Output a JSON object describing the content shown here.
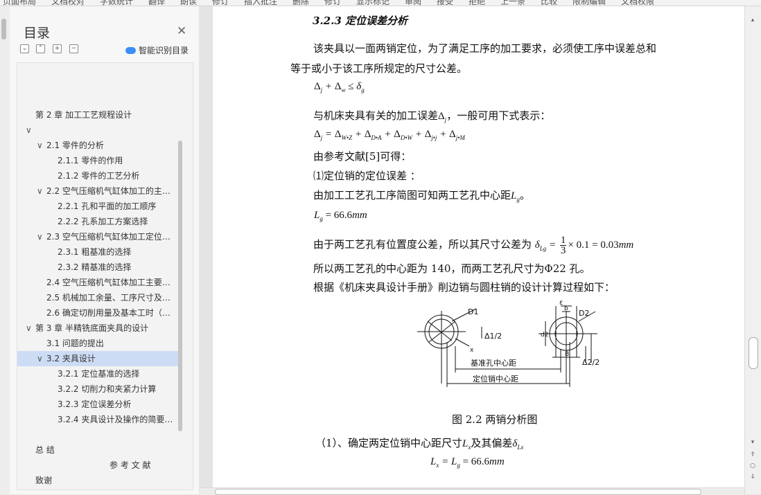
{
  "toolbar": {
    "items": [
      "页面布局",
      "文档校对",
      "字数统计",
      "翻译",
      "朗读",
      "修订",
      "插入批注",
      "删除",
      "修订",
      "显示标记",
      "审阅",
      "接受",
      "拒绝",
      "上一条",
      "比较",
      "限制编辑",
      "文档权限"
    ]
  },
  "toc": {
    "title": "目录",
    "ai_label": "智能识别目录",
    "tool_icons": [
      "⌄",
      "⌃",
      "+",
      "−"
    ],
    "items": [
      {
        "label": "第 2 章  加工工艺规程设计",
        "level": 0
      },
      {
        "label": "",
        "level": 0,
        "expander": "∨"
      },
      {
        "label": "2.1  零件的分析",
        "level": 1,
        "expander": "∨"
      },
      {
        "label": "2.1.1  零件的作用",
        "level": 2
      },
      {
        "label": "2.1.2  零件的工艺分析",
        "level": 2
      },
      {
        "label": "2.2  空气压缩机气缸体加工的主…",
        "level": 1,
        "expander": "∨"
      },
      {
        "label": "2.2.1  孔和平面的加工顺序",
        "level": 2
      },
      {
        "label": "2.2.2  孔系加工方案选择",
        "level": 2
      },
      {
        "label": "2.3  空气压缩机气缸体加工定位…",
        "level": 1,
        "expander": "∨"
      },
      {
        "label": "2.3.1  粗基准的选择",
        "level": 2
      },
      {
        "label": "2.3.2  精基准的选择",
        "level": 2
      },
      {
        "label": "2.4  空气压缩机气缸体加工主要…",
        "level": 1
      },
      {
        "label": "2.5  机械加工余量、工序尺寸及…",
        "level": 1
      },
      {
        "label": "2.6 确定切削用量及基本工时（…",
        "level": 1
      },
      {
        "label": "第 3 章  半精铣底面夹具的设计",
        "level": 0,
        "expander": "∨"
      },
      {
        "label": "3.1  问题的提出",
        "level": 1
      },
      {
        "label": "3.2  夹具设计",
        "level": 1,
        "expander": "∨",
        "selected": true
      },
      {
        "label": "3.2.1  定位基准的选择",
        "level": 2
      },
      {
        "label": "3.2.2 切削力和夹紧力计算",
        "level": 2
      },
      {
        "label": "3.2.3 定位误差分析",
        "level": 2
      },
      {
        "label": "3.2.4 夹具设计及操作的简要…",
        "level": 2
      },
      {
        "label": "",
        "level": 0
      },
      {
        "label": "总  结",
        "level": 0
      },
      {
        "label": "参 考 文 献",
        "level": 3
      },
      {
        "label": "致谢",
        "level": 0
      }
    ]
  },
  "doc": {
    "heading": "3.2.3 定位误差分析",
    "p1_line1": "该夹具以一面两销定位，为了满足工序的加工要求，必须使工序中误差总和",
    "p1_line2": "等于或小于该工序所规定的尺寸公差。",
    "p2_pre": "与机床夹具有关的加工误差",
    "p2_post": "，一般可用下式表示：",
    "ref_line": "由参考文献[5]可得：",
    "item1": "⑴定位销的定位误差 ：",
    "l_lg_pre": "由加工工艺孔工序简图可知两工艺孔中心距",
    "l_lg_post": "。",
    "eq_lg_val": "= 66.6",
    "tol_pre": "由于两工艺孔有位置度公差，所以其尺寸公差为",
    "tol_expr": "× 0.1 = 0.03",
    "dist_line": "所以两工艺孔的中心距为  140，而两工艺孔尺寸为Φ22 孔。",
    "handbook_line": "根据《机床夹具设计手册》削边销与圆柱销的设计计算过程如下：",
    "figure": {
      "label_d1": "D1",
      "label_d2": "D2",
      "label_half1": "Δ1/2",
      "label_half2": "Δ2/2",
      "label_base": "基准孔中心距",
      "label_pin": "定位销中心距",
      "label_eps": "ε",
      "label_b": "b",
      "label_B": "B",
      "label_d2s": "d2",
      "label_x": "x"
    },
    "caption": "图 2.2    两销分析图",
    "item2_pre": "（1）、确定两定位销中心距尺寸",
    "item2_mid": "及其偏差",
    "unit_mm": "mm",
    "frac_num": "1",
    "frac_den": "3",
    "eq_lx": "= 66.6"
  },
  "scroll": {
    "up": "▴",
    "down": "▾",
    "top_btn": "⇑",
    "mid_btn": "○",
    "bot_btn": "⇓"
  }
}
